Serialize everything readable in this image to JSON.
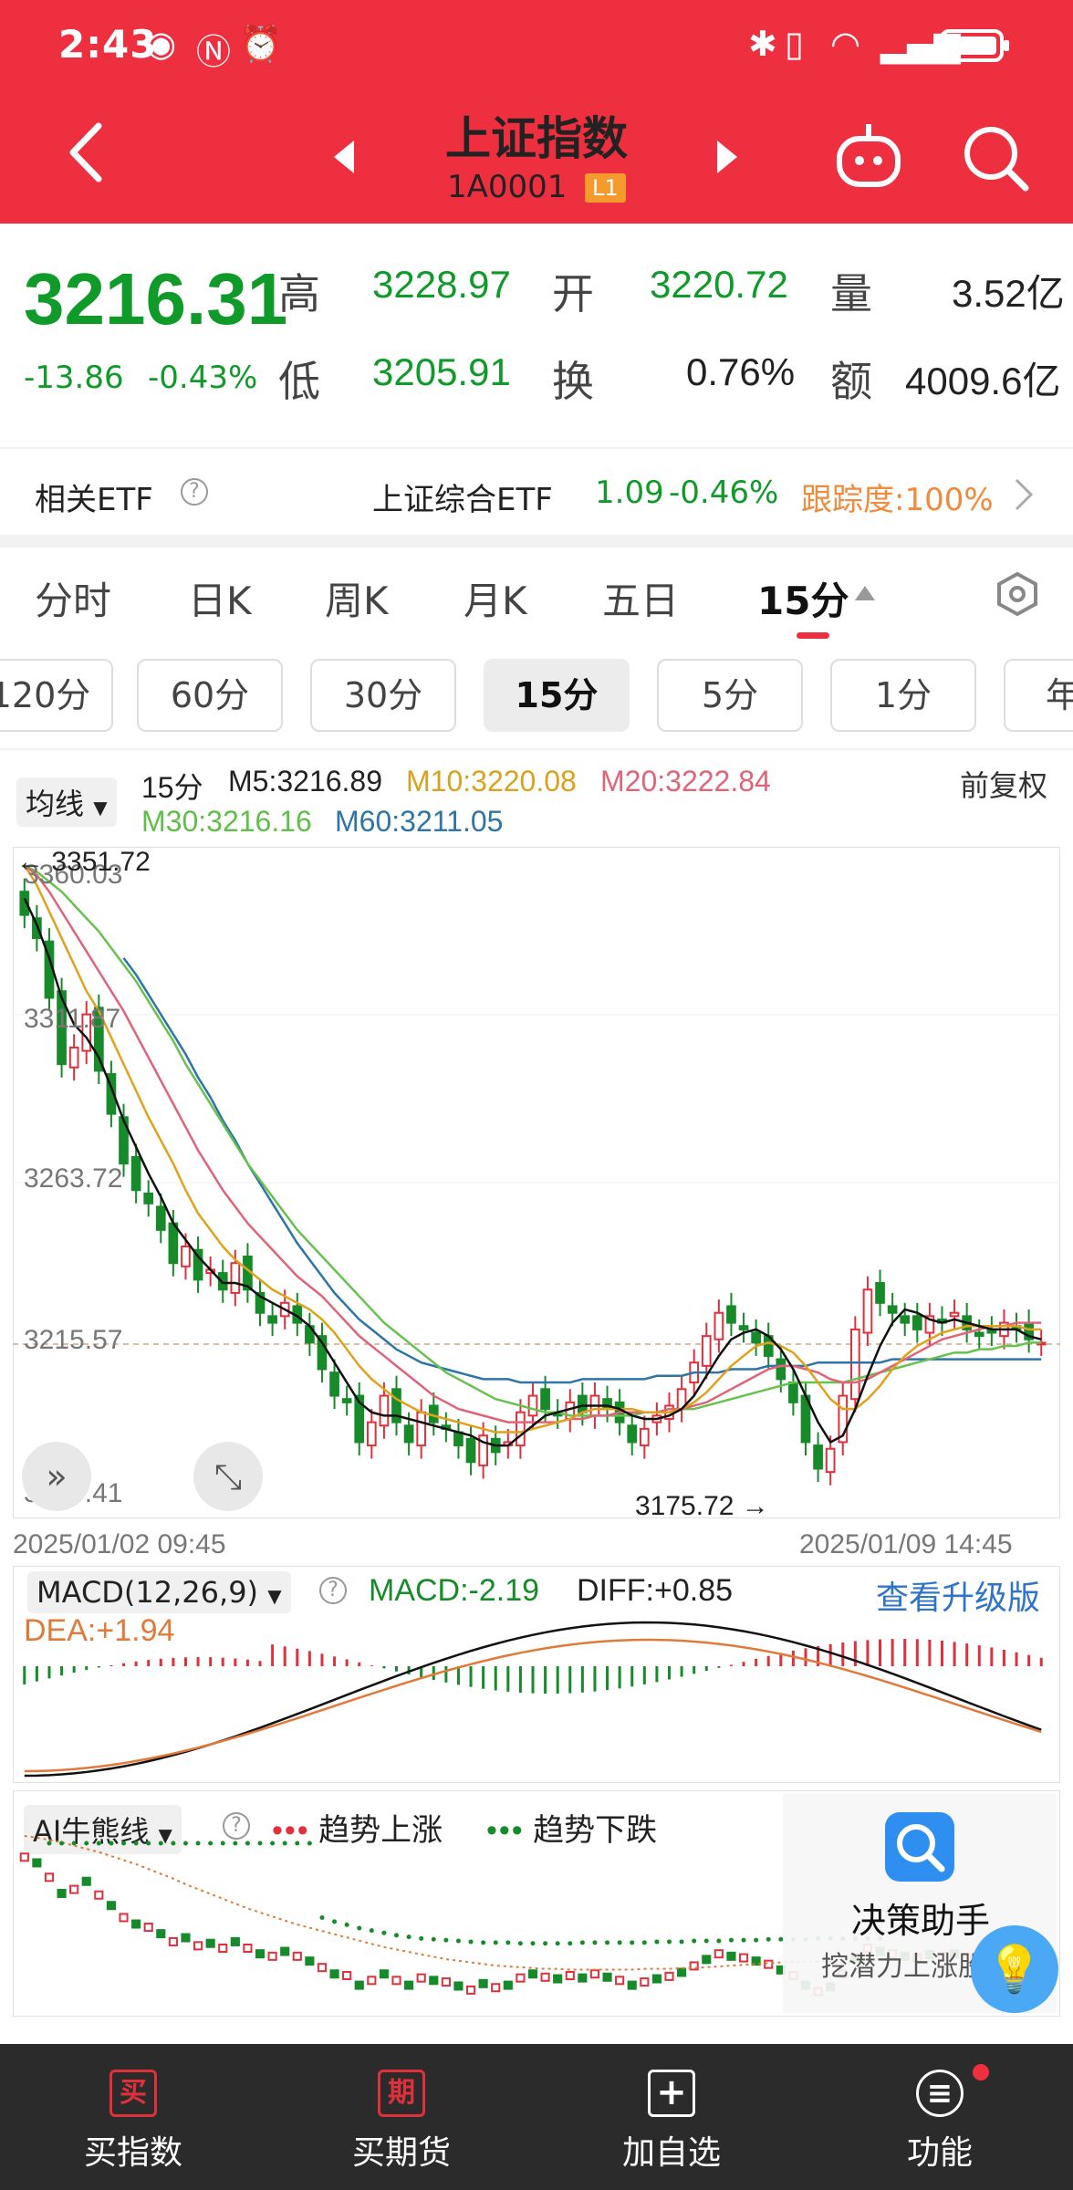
{
  "status": {
    "time": "2:43"
  },
  "header": {
    "title": "上证指数",
    "code": "1A0001",
    "level": "L1"
  },
  "quote": {
    "price": "3216.31",
    "change": "-13.86",
    "change_pct": "-0.43%",
    "high_label": "高",
    "high": "3228.97",
    "open_label": "开",
    "open": "3220.72",
    "volume_label": "量",
    "volume": "3.52亿",
    "low_label": "低",
    "low": "3205.91",
    "turnover_label": "换",
    "turnover": "0.76%",
    "amount_label": "额",
    "amount": "4009.6亿"
  },
  "etf": {
    "label": "相关ETF",
    "name": "上证综合ETF",
    "value": "1.09",
    "change": "-0.46%",
    "tracking": "跟踪度:100%"
  },
  "tabs": [
    "分时",
    "日K",
    "周K",
    "月K",
    "五日",
    "15分"
  ],
  "periods": [
    "120分",
    "60分",
    "30分",
    "15分",
    "5分",
    "1分",
    "年"
  ],
  "legend": {
    "selector": "均线",
    "period": "15分",
    "m5": "M5:3216.89",
    "m10": "M10:3220.08",
    "m20": "M20:3222.84",
    "m30": "M30:3216.16",
    "m60": "M60:3211.05",
    "adjust": "前复权"
  },
  "colors": {
    "up": "#e0303c",
    "down": "#178a2a",
    "m5": "#111111",
    "m10": "#e0a21c",
    "m20": "#e06478",
    "m30": "#67c14e",
    "m60": "#2f74a8",
    "header": "#ee2f3f"
  },
  "price_axis": {
    "ticks": [
      "3360.03",
      "3311.87",
      "3263.72",
      "3215.57",
      "3167.41"
    ]
  },
  "annotations": {
    "high": "3351.72",
    "low": "3175.72"
  },
  "date_range": {
    "start": "2025/01/02 09:45",
    "end": "2025/01/09 14:45"
  },
  "macd": {
    "selector": "MACD(12,26,9)",
    "macd": "MACD:-2.19",
    "diff": "DIFF:+0.85",
    "dea": "DEA:+1.94",
    "upgrade": "查看升级版"
  },
  "ai": {
    "selector": "AI牛熊线",
    "up_label": "趋势上涨",
    "down_label": "趋势下跌",
    "assistant_title": "决策助手",
    "assistant_sub": "挖潜力上涨股"
  },
  "bottom_nav": [
    {
      "icon": "买",
      "label": "买指数"
    },
    {
      "icon": "期",
      "label": "买期货"
    },
    {
      "icon": "+",
      "label": "加自选"
    },
    {
      "icon": "≡",
      "label": "功能"
    }
  ],
  "chart_data": {
    "type": "candlestick",
    "x_start": "2025/01/02 09:45",
    "x_end": "2025/01/09 14:45",
    "ylim": [
      3167.41,
      3360.03
    ],
    "close": [
      3345,
      3338,
      3320,
      3300,
      3305,
      3315,
      3298,
      3285,
      3270,
      3262,
      3258,
      3250,
      3240,
      3245,
      3235,
      3238,
      3232,
      3240,
      3232,
      3225,
      3222,
      3228,
      3222,
      3216,
      3208,
      3200,
      3198,
      3186,
      3192,
      3200,
      3192,
      3186,
      3195,
      3192,
      3190,
      3185,
      3180,
      3188,
      3183,
      3186,
      3195,
      3200,
      3196,
      3194,
      3198,
      3195,
      3200,
      3196,
      3192,
      3186,
      3190,
      3194,
      3197,
      3202,
      3210,
      3218,
      3225,
      3222,
      3220,
      3216,
      3212,
      3205,
      3198,
      3186,
      3178,
      3184,
      3200,
      3220,
      3232,
      3228,
      3225,
      3222,
      3220,
      3224,
      3222,
      3225,
      3220,
      3218,
      3219,
      3222,
      3220,
      3217,
      3216
    ],
    "ma5": [
      3350,
      3342,
      3332,
      3320,
      3312,
      3308,
      3302,
      3293,
      3283,
      3275,
      3267,
      3260,
      3252,
      3247,
      3242,
      3238,
      3234,
      3234,
      3233,
      3230,
      3228,
      3226,
      3224,
      3221,
      3216,
      3210,
      3204,
      3198,
      3195,
      3194,
      3194,
      3193,
      3192,
      3191,
      3190,
      3189,
      3188,
      3186,
      3185,
      3185,
      3188,
      3191,
      3194,
      3195,
      3196,
      3197,
      3197,
      3197,
      3196,
      3194,
      3193,
      3193,
      3194,
      3196,
      3200,
      3206,
      3212,
      3217,
      3219,
      3220,
      3218,
      3214,
      3208,
      3200,
      3192,
      3186,
      3188,
      3196,
      3206,
      3215,
      3222,
      3226,
      3225,
      3223,
      3222,
      3223,
      3222,
      3221,
      3220,
      3220,
      3220,
      3218,
      3217
    ],
    "ma10": [
      3360,
      3354,
      3346,
      3338,
      3330,
      3322,
      3316,
      3308,
      3300,
      3292,
      3284,
      3277,
      3270,
      3262,
      3255,
      3250,
      3245,
      3241,
      3238,
      3235,
      3232,
      3230,
      3228,
      3226,
      3223,
      3219,
      3214,
      3209,
      3205,
      3202,
      3199,
      3197,
      3195,
      3194,
      3193,
      3192,
      3191,
      3190,
      3189,
      3189,
      3189,
      3190,
      3191,
      3192,
      3193,
      3195,
      3196,
      3196,
      3196,
      3196,
      3195,
      3195,
      3195,
      3196,
      3198,
      3201,
      3205,
      3209,
      3212,
      3215,
      3216,
      3215,
      3213,
      3209,
      3204,
      3199,
      3196,
      3196,
      3199,
      3203,
      3208,
      3212,
      3215,
      3217,
      3219,
      3220,
      3221,
      3221,
      3221,
      3221,
      3221,
      3220,
      3220
    ],
    "ma20": [
      3360,
      3357,
      3352,
      3346,
      3340,
      3334,
      3328,
      3322,
      3316,
      3309,
      3302,
      3295,
      3288,
      3281,
      3274,
      3268,
      3262,
      3257,
      3252,
      3248,
      3244,
      3240,
      3236,
      3233,
      3230,
      3226,
      3222,
      3218,
      3215,
      3212,
      3209,
      3206,
      3203,
      3200,
      3198,
      3196,
      3195,
      3194,
      3193,
      3192,
      3192,
      3192,
      3192,
      3192,
      3193,
      3193,
      3194,
      3194,
      3195,
      3195,
      3195,
      3195,
      3196,
      3196,
      3197,
      3198,
      3200,
      3202,
      3204,
      3206,
      3208,
      3209,
      3209,
      3208,
      3207,
      3205,
      3204,
      3204,
      3205,
      3207,
      3209,
      3211,
      3213,
      3215,
      3217,
      3218,
      3219,
      3220,
      3221,
      3221,
      3222,
      3222,
      3222
    ],
    "ma30": [
      3360,
      3358,
      3355,
      3352,
      3348,
      3344,
      3340,
      3335,
      3330,
      3325,
      3319,
      3313,
      3307,
      3300,
      3294,
      3288,
      3282,
      3276,
      3270,
      3265,
      3260,
      3255,
      3250,
      3246,
      3242,
      3238,
      3234,
      3230,
      3226,
      3222,
      3219,
      3216,
      3213,
      3210,
      3207,
      3205,
      3203,
      3201,
      3199,
      3198,
      3197,
      3196,
      3195,
      3195,
      3194,
      3194,
      3194,
      3194,
      3194,
      3194,
      3195,
      3195,
      3195,
      3196,
      3196,
      3197,
      3198,
      3199,
      3200,
      3201,
      3202,
      3203,
      3204,
      3204,
      3204,
      3204,
      3204,
      3205,
      3206,
      3207,
      3208,
      3209,
      3210,
      3211,
      3212,
      3213,
      3213,
      3214,
      3214,
      3215,
      3215,
      3216,
      3216
    ],
    "ma60": [
      3360,
      3358,
      3356,
      3353,
      3350,
      3346,
      3342,
      3337,
      3332,
      3327,
      3321,
      3315,
      3309,
      3303,
      3296,
      3290,
      3283,
      3277,
      3270,
      3264,
      3258,
      3252,
      3246,
      3241,
      3236,
      3231,
      3227,
      3223,
      3220,
      3217,
      3214,
      3212,
      3210,
      3209,
      3208,
      3207,
      3206,
      3205,
      3205,
      3205,
      3204,
      3204,
      3204,
      3204,
      3204,
      3205,
      3205,
      3205,
      3205,
      3205,
      3205,
      3206,
      3206,
      3206,
      3207,
      3207,
      3207,
      3208,
      3208,
      3208,
      3209,
      3209,
      3209,
      3209,
      3210,
      3210,
      3210,
      3210,
      3210,
      3210,
      3211,
      3211,
      3211,
      3211,
      3211,
      3211,
      3211,
      3211,
      3211,
      3211,
      3211,
      3211,
      3211
    ]
  }
}
